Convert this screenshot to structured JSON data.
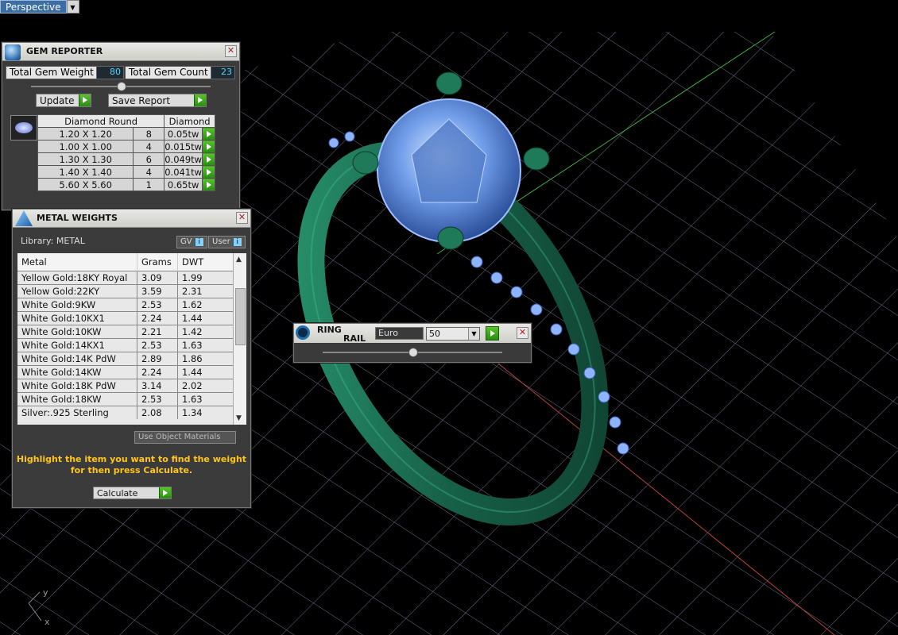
{
  "viewport": {
    "label": "Perspective",
    "axis_y": "y",
    "axis_x": "x"
  },
  "gem_reporter": {
    "title": "GEM REPORTER",
    "weight_label": "Total Gem Weight",
    "weight_value": "80",
    "count_label": "Total Gem Count",
    "count_value": "23",
    "update_label": "Update",
    "save_label": "Save Report",
    "col_shape": "Diamond Round",
    "col_type": "Diamond",
    "rows": [
      {
        "size": "1.20 X 1.20",
        "count": "8",
        "tw": "0.05tw"
      },
      {
        "size": "1.00 X 1.00",
        "count": "4",
        "tw": "0.015tw"
      },
      {
        "size": "1.30 X 1.30",
        "count": "6",
        "tw": "0.049tw"
      },
      {
        "size": "1.40 X 1.40",
        "count": "4",
        "tw": "0.041tw"
      },
      {
        "size": "5.60 X 5.60",
        "count": "1",
        "tw": "0.65tw"
      }
    ]
  },
  "metal_weights": {
    "title": "METAL WEIGHTS",
    "library": "Library: METAL",
    "gv": "GV",
    "user": "User",
    "col_metal": "Metal",
    "col_grams": "Grams",
    "col_dwt": "DWT",
    "rows": [
      {
        "metal": "Yellow Gold:18KY Royal",
        "grams": "3.09",
        "dwt": "1.99"
      },
      {
        "metal": "Yellow Gold:22KY",
        "grams": "3.59",
        "dwt": "2.31"
      },
      {
        "metal": "White Gold:9KW",
        "grams": "2.53",
        "dwt": "1.62"
      },
      {
        "metal": "White Gold:10KX1",
        "grams": "2.24",
        "dwt": "1.44"
      },
      {
        "metal": "White Gold:10KW",
        "grams": "2.21",
        "dwt": "1.42"
      },
      {
        "metal": "White Gold:14KX1",
        "grams": "2.53",
        "dwt": "1.63"
      },
      {
        "metal": "White Gold:14K PdW",
        "grams": "2.89",
        "dwt": "1.86"
      },
      {
        "metal": "White Gold:14KW",
        "grams": "2.24",
        "dwt": "1.44"
      },
      {
        "metal": "White Gold:18K PdW",
        "grams": "3.14",
        "dwt": "2.02"
      },
      {
        "metal": "White Gold:18KW",
        "grams": "2.53",
        "dwt": "1.63"
      },
      {
        "metal": "Silver:.925 Sterling",
        "grams": "2.08",
        "dwt": "1.34"
      }
    ],
    "use_object_materials": "Use Object Materials",
    "hint_line1": "Highlight the item you want to find the weight",
    "hint_line2": "for then press Calculate.",
    "calculate": "Calculate"
  },
  "ring_rail": {
    "title1": "RING",
    "title2": "RAIL",
    "system": "Euro",
    "size": "50"
  },
  "colors": {
    "accent_green": "#3aa818",
    "ring_green": "#1f7a5a",
    "gem_blue": "#7aa6f0",
    "grid": "#9aa0ff"
  }
}
